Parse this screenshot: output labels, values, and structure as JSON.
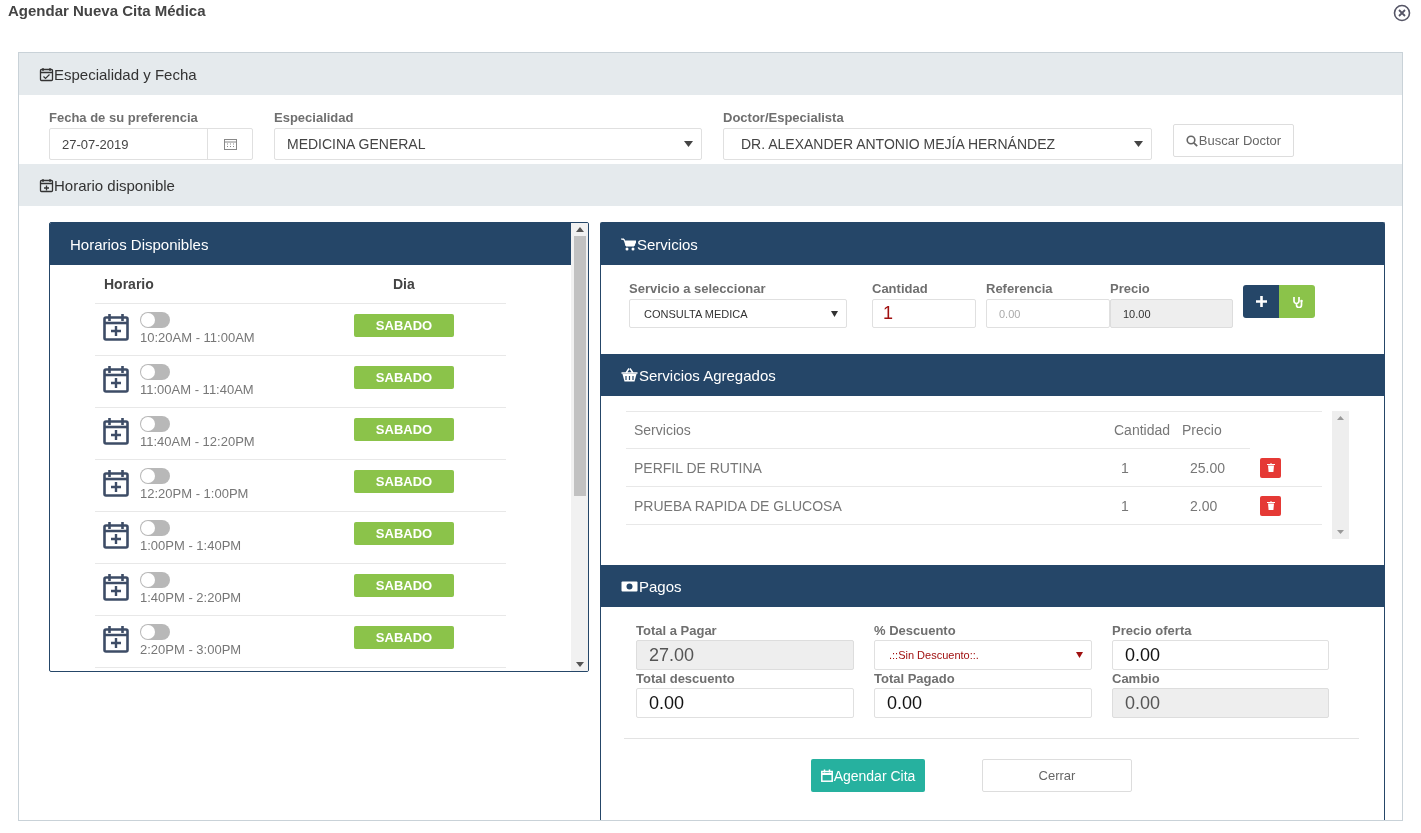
{
  "dialog": {
    "title": "Agendar Nueva Cita Médica"
  },
  "especialidad_y_fecha": {
    "title": "Especialidad y Fecha",
    "fields": [
      {
        "kind": "date",
        "label": "Fecha de su preferencia",
        "value": "27-07-2019"
      },
      {
        "kind": "select",
        "label": "Especialidad",
        "value": "MEDICINA GENERAL"
      },
      {
        "kind": "select",
        "label": "Doctor/Especialista",
        "value": "DR. ALEXANDER ANTONIO MEJÍA HERNÁNDEZ"
      }
    ],
    "search_button": "Buscar Doctor"
  },
  "horario_disponible": {
    "title": "Horario disponible"
  },
  "horarios": {
    "title": "Horarios Disponibles",
    "columns": [
      "Horario",
      "Dia"
    ],
    "slots": [
      {
        "time": "10:20AM - 11:00AM",
        "day": "SABADO",
        "on": false
      },
      {
        "time": "11:00AM - 11:40AM",
        "day": "SABADO",
        "on": false
      },
      {
        "time": "11:40AM - 12:20PM",
        "day": "SABADO",
        "on": false
      },
      {
        "time": "12:20PM - 1:00PM",
        "day": "SABADO",
        "on": false
      },
      {
        "time": "1:00PM - 1:40PM",
        "day": "SABADO",
        "on": false
      },
      {
        "time": "1:40PM - 2:20PM",
        "day": "SABADO",
        "on": false
      },
      {
        "time": "2:20PM - 3:00PM",
        "day": "SABADO",
        "on": false
      }
    ]
  },
  "servicios": {
    "title": "Servicios",
    "fields": [
      {
        "kind": "select",
        "label": "Servicio a seleccionar",
        "value": "CONSULTA MEDICA"
      },
      {
        "kind": "input",
        "label": "Cantidad",
        "value": "1"
      },
      {
        "kind": "input",
        "label": "Referencia",
        "placeholder": "0.00"
      },
      {
        "kind": "readonly",
        "label": "Precio",
        "value": "10.00"
      }
    ]
  },
  "servicios_agregados": {
    "title": "Servicios Agregados",
    "columns": [
      "Servicios",
      "Cantidad",
      "Precio"
    ],
    "rows": [
      {
        "servicio": "PERFIL DE RUTINA",
        "cantidad": "1",
        "precio": "25.00"
      },
      {
        "servicio": "PRUEBA RAPIDA DE GLUCOSA",
        "cantidad": "1",
        "precio": "2.00"
      }
    ]
  },
  "pagos": {
    "title": "Pagos",
    "fields": [
      {
        "kind": "readonly",
        "label": "Total a Pagar",
        "value": "27.00"
      },
      {
        "kind": "select",
        "label": "% Descuento",
        "value": ".::Sin Descuento::."
      },
      {
        "kind": "input",
        "label": "Precio oferta",
        "value": "0.00"
      },
      {
        "kind": "input",
        "label": "Total descuento",
        "value": "0.00"
      },
      {
        "kind": "input",
        "label": "Total Pagado",
        "value": "0.00"
      },
      {
        "kind": "readonly",
        "label": "Cambio",
        "value": "0.00"
      }
    ]
  },
  "buttons": [
    {
      "kind": "primary",
      "label": "Agendar Cita"
    },
    {
      "kind": "default",
      "label": "Cerrar"
    }
  ]
}
